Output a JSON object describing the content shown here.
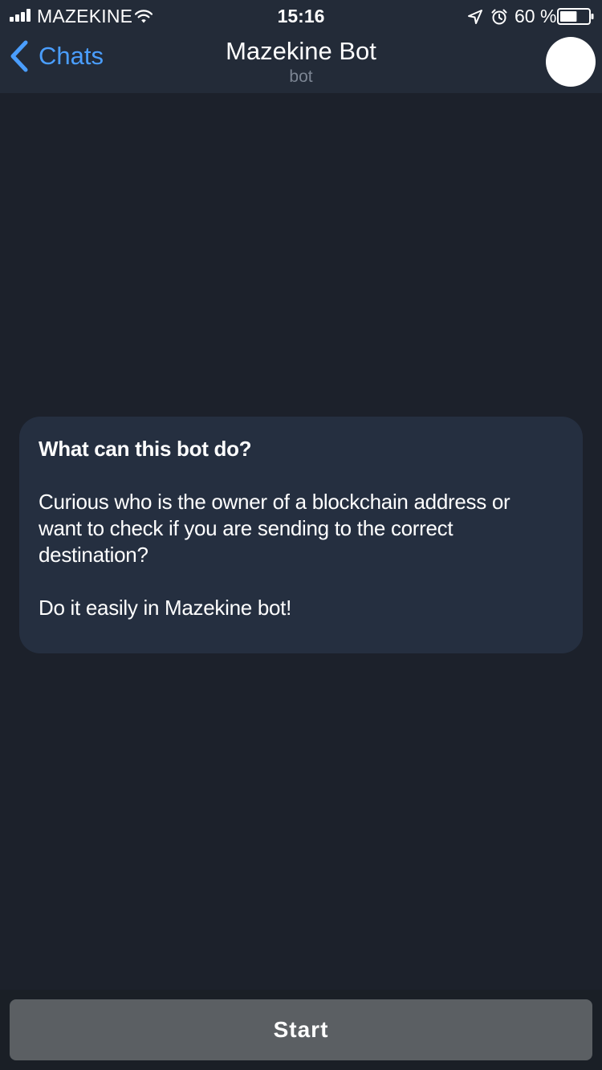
{
  "status_bar": {
    "carrier": "MAZEKINE",
    "time": "15:16",
    "battery_percent": "60 %",
    "battery_level": 0.6
  },
  "nav": {
    "back_label": "Chats",
    "title": "Mazekine Bot",
    "subtitle": "bot"
  },
  "info_card": {
    "title": "What can this bot do?",
    "body": "Curious who is the owner of a blockchain address or want to check if you are sending to the correct destination?",
    "footer": "Do it easily in Mazekine bot!"
  },
  "actions": {
    "start_label": "Start"
  },
  "colors": {
    "background": "#1c212b",
    "header": "#232b38",
    "accent": "#4a9eff",
    "card": "#252f40",
    "button": "#5b5f63"
  },
  "icons": {
    "signal": "signal-bars-icon",
    "wifi": "wifi-icon",
    "location": "location-arrow-icon",
    "alarm": "alarm-clock-icon",
    "battery": "battery-icon",
    "back": "chevron-left-icon"
  }
}
